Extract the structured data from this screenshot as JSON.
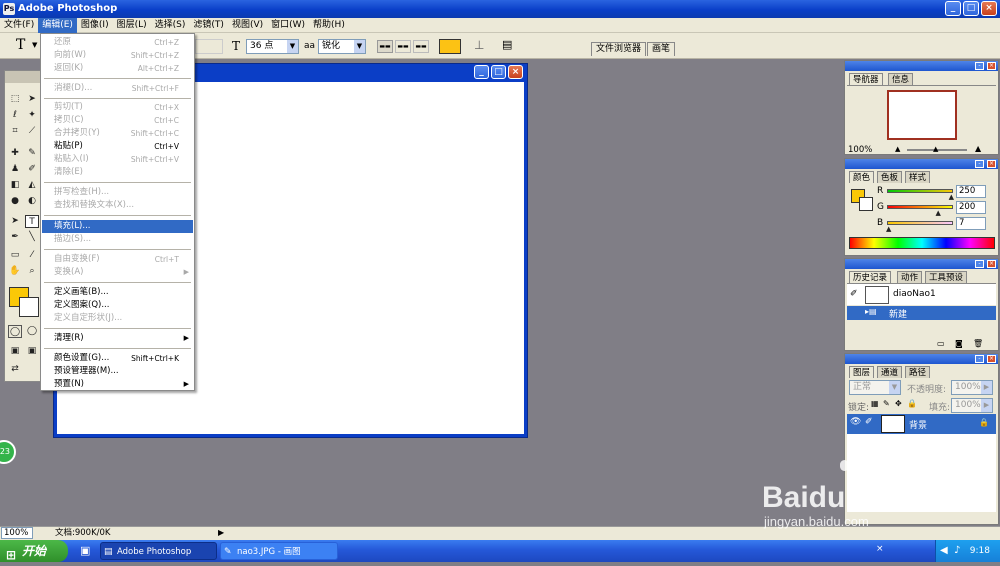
{
  "window": {
    "title": "Adobe Photoshop",
    "icon": "photoshop-icon"
  },
  "menubar": [
    {
      "label": "文件(F)"
    },
    {
      "label": "编辑(E)"
    },
    {
      "label": "图像(I)"
    },
    {
      "label": "图层(L)"
    },
    {
      "label": "选择(S)"
    },
    {
      "label": "滤镜(T)"
    },
    {
      "label": "视图(V)"
    },
    {
      "label": "窗口(W)"
    },
    {
      "label": "帮助(H)"
    }
  ],
  "options": {
    "tool_icon": "T",
    "font_size": "36 点",
    "aa_icon": "aa",
    "aa_mode": "锐化",
    "tab_file_browser": "文件浏览器",
    "tab_brushes": "画笔",
    "text_color": "#fcc214"
  },
  "edit_menu": {
    "items": [
      {
        "label": "还原",
        "shortcut": "Ctrl+Z",
        "disabled": true
      },
      {
        "label": "向前(W)",
        "shortcut": "Shift+Ctrl+Z",
        "disabled": true
      },
      {
        "label": "返回(K)",
        "shortcut": "Alt+Ctrl+Z",
        "disabled": true
      },
      {
        "label": "消褪(D)...",
        "shortcut": "Shift+Ctrl+F",
        "disabled": true
      },
      {
        "label": "剪切(T)",
        "shortcut": "Ctrl+X",
        "disabled": true
      },
      {
        "label": "拷贝(C)",
        "shortcut": "Ctrl+C",
        "disabled": true
      },
      {
        "label": "合并拷贝(Y)",
        "shortcut": "Shift+Ctrl+C",
        "disabled": true
      },
      {
        "label": "粘贴(P)",
        "shortcut": "Ctrl+V",
        "disabled": false
      },
      {
        "label": "粘贴入(I)",
        "shortcut": "Shift+Ctrl+V",
        "disabled": true
      },
      {
        "label": "清除(E)",
        "shortcut": "",
        "disabled": true
      },
      {
        "label": "拼写检查(H)...",
        "shortcut": "",
        "disabled": true
      },
      {
        "label": "查找和替换文本(X)...",
        "shortcut": "",
        "disabled": true
      },
      {
        "label": "填充(L)...",
        "shortcut": "",
        "disabled": false,
        "highlighted": true
      },
      {
        "label": "描边(S)...",
        "shortcut": "",
        "disabled": true
      },
      {
        "label": "自由变换(F)",
        "shortcut": "Ctrl+T",
        "disabled": true
      },
      {
        "label": "变换(A)",
        "shortcut": "",
        "disabled": true,
        "submenu": true
      },
      {
        "label": "定义画笔(B)...",
        "shortcut": "",
        "disabled": false
      },
      {
        "label": "定义图案(Q)...",
        "shortcut": "",
        "disabled": false
      },
      {
        "label": "定义自定形状(J)...",
        "shortcut": "",
        "disabled": true
      },
      {
        "label": "清理(R)",
        "shortcut": "",
        "disabled": false,
        "submenu": true
      },
      {
        "label": "颜色设置(G)...",
        "shortcut": "Shift+Ctrl+K",
        "disabled": false
      },
      {
        "label": "预设管理器(M)...",
        "shortcut": "",
        "disabled": false
      },
      {
        "label": "预置(N)",
        "shortcut": "",
        "disabled": false,
        "submenu": true
      }
    ]
  },
  "navigator": {
    "tabs": [
      "导航器",
      "信息"
    ],
    "zoom": "100%"
  },
  "color_panel": {
    "tabs": [
      "颜色",
      "色板",
      "样式"
    ],
    "channels": [
      {
        "label": "R",
        "value": "250",
        "level": 0.98
      },
      {
        "label": "G",
        "value": "200",
        "level": 0.78
      },
      {
        "label": "B",
        "value": "7",
        "level": 0.03
      }
    ],
    "fg_color": "#fac807",
    "bg_color": "#ffffff"
  },
  "history_panel": {
    "tabs": [
      "历史记录",
      "动作",
      "工具预设"
    ],
    "snapshot": "diaoNao1",
    "states": [
      "新建"
    ]
  },
  "layers_panel": {
    "tabs": [
      "图层",
      "通道",
      "路径"
    ],
    "blend_mode": "正常",
    "opacity_label": "不透明度:",
    "opacity": "100%",
    "lock_label": "锁定:",
    "fill_label": "填充:",
    "fill": "100%",
    "layers": [
      {
        "name": "背景"
      }
    ]
  },
  "status": {
    "zoom": "100%",
    "doc_info": "文档:900K/0K"
  },
  "taskbar": {
    "start": "开始",
    "buttons": [
      "Adobe Photoshop",
      "nao3.JPG - 画图"
    ],
    "clock": "9:18"
  },
  "watermark": {
    "brand": "Baidu 经验",
    "url": "jingyan.baidu.com"
  },
  "badge": "23"
}
